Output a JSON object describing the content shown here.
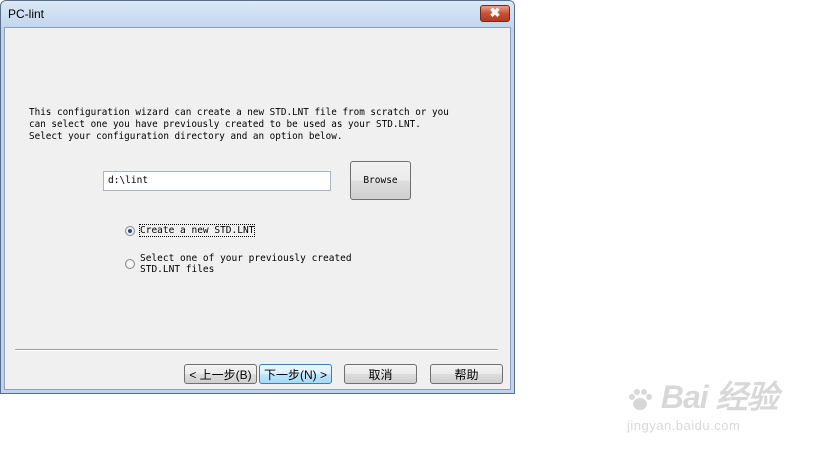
{
  "window": {
    "title": "PC-lint",
    "close_glyph": "✖"
  },
  "intro": {
    "lines": [
      "This configuration wizard can create a new STD.LNT file from scratch or you",
      "can select one you have previously created to be used as your STD.LNT.",
      "Select your configuration directory and an option below."
    ]
  },
  "directory": {
    "value": "d:\\lint",
    "browse_label": "Browse"
  },
  "options": {
    "create_new": {
      "label": "Create a new STD.LNT",
      "checked": true
    },
    "select_existing": {
      "label_line1": "Select one of your previously created",
      "label_line2": "STD.LNT files",
      "checked": false
    }
  },
  "buttons": {
    "back": "< 上一步(B)",
    "next": "下一步(N) >",
    "cancel": "取消",
    "help": "帮助"
  },
  "watermark": {
    "logo_text": "Bai  经验",
    "sub_text": "jingyan.baidu.com"
  },
  "colors": {
    "title_bar": "#c3d6ee",
    "dialog_bg": "#f0f0f0",
    "close_button": "#c75035",
    "radio_dot": "#1a4f9c"
  }
}
